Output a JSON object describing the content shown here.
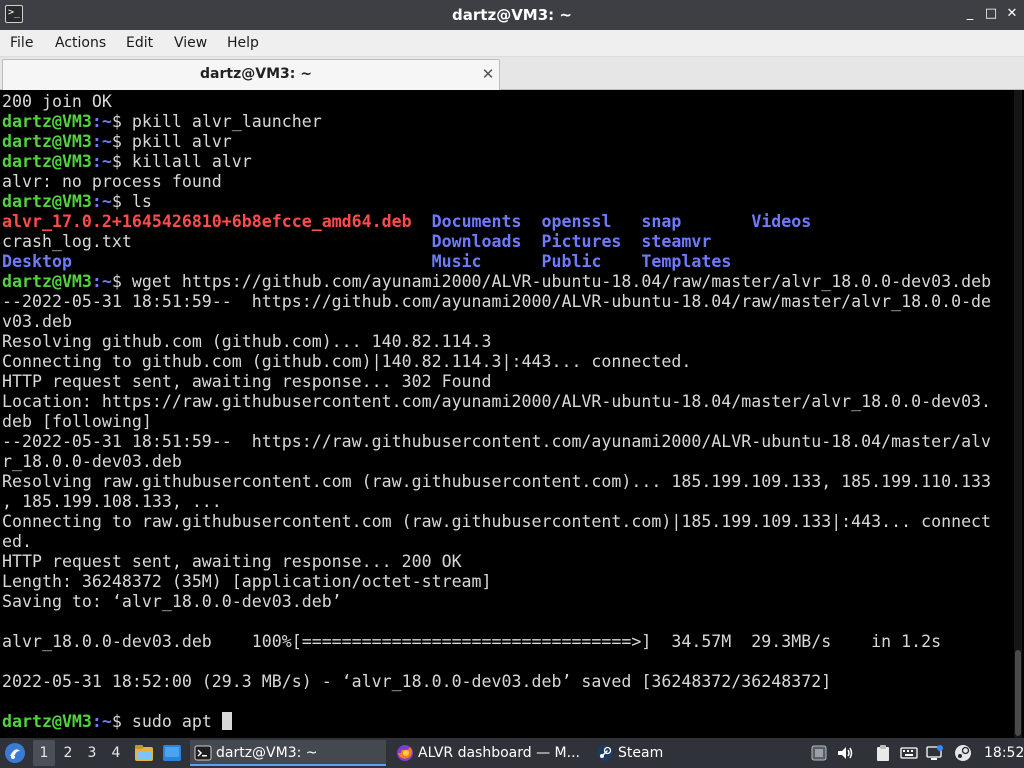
{
  "window": {
    "title": "dartz@VM3: ~",
    "minimize_glyph": "_",
    "maximize_glyph": "□",
    "close_glyph": "✕"
  },
  "menu": [
    "File",
    "Actions",
    "Edit",
    "View",
    "Help"
  ],
  "tab": {
    "label": "dartz@VM3: ~",
    "close_glyph": "✕"
  },
  "terminal": {
    "prompt_user": "dartz@VM3",
    "prompt_path": ":~",
    "prompt_dollar": "$ ",
    "lines": [
      {
        "type": "text",
        "text": "200 join OK"
      },
      {
        "type": "prompt",
        "cmd": "pkill alvr_launcher"
      },
      {
        "type": "prompt",
        "cmd": "pkill alvr"
      },
      {
        "type": "prompt",
        "cmd": "killall alvr"
      },
      {
        "type": "text",
        "text": "alvr: no process found"
      },
      {
        "type": "prompt",
        "cmd": "ls"
      },
      {
        "type": "ls",
        "cells": [
          {
            "text": "alvr_17.0.2+1645426810+6b8efcce_amd64.deb",
            "col": 0,
            "kind": "deb"
          },
          {
            "text": "Documents",
            "col": 43,
            "kind": "dir"
          },
          {
            "text": "openssl",
            "col": 54,
            "kind": "dir"
          },
          {
            "text": "snap",
            "col": 64,
            "kind": "dir"
          },
          {
            "text": "Videos",
            "col": 75,
            "kind": "dir"
          }
        ]
      },
      {
        "type": "ls",
        "cells": [
          {
            "text": "crash_log.txt",
            "col": 0,
            "kind": "file"
          },
          {
            "text": "Downloads",
            "col": 43,
            "kind": "dir"
          },
          {
            "text": "Pictures",
            "col": 54,
            "kind": "dir"
          },
          {
            "text": "steamvr",
            "col": 64,
            "kind": "dir"
          }
        ]
      },
      {
        "type": "ls",
        "cells": [
          {
            "text": "Desktop",
            "col": 0,
            "kind": "dir"
          },
          {
            "text": "Music",
            "col": 43,
            "kind": "dir"
          },
          {
            "text": "Public",
            "col": 54,
            "kind": "dir"
          },
          {
            "text": "Templates",
            "col": 64,
            "kind": "dir"
          }
        ]
      },
      {
        "type": "prompt",
        "cmd": "wget https://github.com/ayunami2000/ALVR-ubuntu-18.04/raw/master/alvr_18.0.0-dev03.deb"
      },
      {
        "type": "text",
        "text": "--2022-05-31 18:51:59--  https://github.com/ayunami2000/ALVR-ubuntu-18.04/raw/master/alvr_18.0.0-de"
      },
      {
        "type": "text",
        "text": "v03.deb"
      },
      {
        "type": "text",
        "text": "Resolving github.com (github.com)... 140.82.114.3"
      },
      {
        "type": "text",
        "text": "Connecting to github.com (github.com)|140.82.114.3|:443... connected."
      },
      {
        "type": "text",
        "text": "HTTP request sent, awaiting response... 302 Found"
      },
      {
        "type": "text",
        "text": "Location: https://raw.githubusercontent.com/ayunami2000/ALVR-ubuntu-18.04/master/alvr_18.0.0-dev03."
      },
      {
        "type": "text",
        "text": "deb [following]"
      },
      {
        "type": "text",
        "text": "--2022-05-31 18:51:59--  https://raw.githubusercontent.com/ayunami2000/ALVR-ubuntu-18.04/master/alv"
      },
      {
        "type": "text",
        "text": "r_18.0.0-dev03.deb"
      },
      {
        "type": "text",
        "text": "Resolving raw.githubusercontent.com (raw.githubusercontent.com)... 185.199.109.133, 185.199.110.133"
      },
      {
        "type": "text",
        "text": ", 185.199.108.133, ..."
      },
      {
        "type": "text",
        "text": "Connecting to raw.githubusercontent.com (raw.githubusercontent.com)|185.199.109.133|:443... connect"
      },
      {
        "type": "text",
        "text": "ed."
      },
      {
        "type": "text",
        "text": "HTTP request sent, awaiting response... 200 OK"
      },
      {
        "type": "text",
        "text": "Length: 36248372 (35M) [application/octet-stream]"
      },
      {
        "type": "text",
        "text": "Saving to: ‘alvr_18.0.0-dev03.deb’"
      },
      {
        "type": "text",
        "text": ""
      },
      {
        "type": "text",
        "text": "alvr_18.0.0-dev03.deb    100%[=================================>]  34.57M  29.3MB/s    in 1.2s"
      },
      {
        "type": "text",
        "text": ""
      },
      {
        "type": "text",
        "text": "2022-05-31 18:52:00 (29.3 MB/s) - ‘alvr_18.0.0-dev03.deb’ saved [36248372/36248372]"
      },
      {
        "type": "text",
        "text": ""
      },
      {
        "type": "prompt",
        "cmd": "sudo apt ",
        "cursor": true
      }
    ]
  },
  "taskbar": {
    "workspaces": [
      "1",
      "2",
      "3",
      "4"
    ],
    "active_workspace": "1",
    "tasks": [
      {
        "label": "dartz@VM3: ~",
        "icon": "terminal-icon",
        "active": true
      },
      {
        "label": "ALVR dashboard — M...",
        "icon": "firefox-icon",
        "active": false
      },
      {
        "label": "Steam",
        "icon": "steam-icon",
        "active": false
      }
    ],
    "clock": "18:52"
  },
  "colors": {
    "prompt_user": "#52d23f",
    "directory": "#6f7bff",
    "deb_file": "#ff4b4b",
    "title_bar": "#3d3f44",
    "taskbar": "#2f3238"
  }
}
